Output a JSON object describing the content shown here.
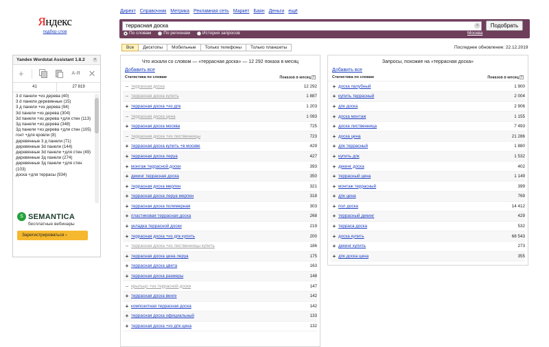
{
  "logo": {
    "main": "Яндекс",
    "sub": "подбор слов"
  },
  "topnav": [
    "Директ",
    "Справочник",
    "Метрика",
    "Рекламная сеть",
    "Маркет",
    "Баян",
    "Деньги",
    "ещё"
  ],
  "search": {
    "value": "террасная доска",
    "submit_label": "Подобрать",
    "modes": [
      "По словам",
      "По регионам",
      "История запросов"
    ],
    "region": "Москва"
  },
  "tabs": [
    "Все",
    "Десктопы",
    "Мобильные",
    "Только телефоны",
    "Только планшеты"
  ],
  "last_update": "Последнее обновление: 22.12.2019",
  "left_panel": {
    "title": "Что искали со словом — «террасная доска» — 12 292 показа в месяц",
    "add_all": "Добавить все",
    "col_words": "Статистика по словам",
    "col_shows": "Показов в месяц",
    "rows": [
      {
        "kw": "террасная доска",
        "cnt": "12 292",
        "sign": "−",
        "used": true
      },
      {
        "kw": "террасная доска купить",
        "cnt": "1 887",
        "sign": "−",
        "used": true
      },
      {
        "kw": "террасная доска +из дпк",
        "cnt": "1 203",
        "sign": "+",
        "used": false
      },
      {
        "kw": "террасная доска цена",
        "cnt": "1 093",
        "sign": "−",
        "used": true
      },
      {
        "kw": "террасная доска москва",
        "cnt": "725",
        "sign": "+",
        "used": false
      },
      {
        "kw": "террасная доска +из лиственницы",
        "cnt": "723",
        "sign": "−",
        "used": true
      },
      {
        "kw": "террасная доска купить +в москве",
        "cnt": "429",
        "sign": "+",
        "used": false
      },
      {
        "kw": "террасная доска леруа",
        "cnt": "427",
        "sign": "+",
        "used": false
      },
      {
        "kw": "монтаж террасной доски",
        "cnt": "393",
        "sign": "+",
        "used": false
      },
      {
        "kw": "декинг террасная доска",
        "cnt": "350",
        "sign": "+",
        "used": false
      },
      {
        "kw": "террасная доска мерлен",
        "cnt": "321",
        "sign": "+",
        "used": false
      },
      {
        "kw": "террасная доска леруа мерлен",
        "cnt": "318",
        "sign": "+",
        "used": false
      },
      {
        "kw": "террасная доска полимерная",
        "cnt": "303",
        "sign": "+",
        "used": false
      },
      {
        "kw": "пластиковая террасная доска",
        "cnt": "268",
        "sign": "+",
        "used": false
      },
      {
        "kw": "укладка террасной доски",
        "cnt": "219",
        "sign": "+",
        "used": false
      },
      {
        "kw": "террасная доска +из дпк купить",
        "cnt": "200",
        "sign": "+",
        "used": false
      },
      {
        "kw": "террасная доска +из лиственницы купить",
        "cnt": "186",
        "sign": "−",
        "used": true
      },
      {
        "kw": "террасная доска цена леруа",
        "cnt": "175",
        "sign": "+",
        "used": false
      },
      {
        "kw": "террасная доска цвета",
        "cnt": "163",
        "sign": "+",
        "used": false
      },
      {
        "kw": "террасная доска размеры",
        "cnt": "148",
        "sign": "+",
        "used": false
      },
      {
        "kw": "крыльцо +из террасной доски",
        "cnt": "147",
        "sign": "−",
        "used": true
      },
      {
        "kw": "террасная доска венге",
        "cnt": "142",
        "sign": "+",
        "used": false
      },
      {
        "kw": "композитная террасная доска",
        "cnt": "142",
        "sign": "+",
        "used": false
      },
      {
        "kw": "террасная доска официальный",
        "cnt": "133",
        "sign": "+",
        "used": false
      },
      {
        "kw": "террасная доска +из дпк цена",
        "cnt": "132",
        "sign": "+",
        "used": false
      }
    ]
  },
  "right_panel": {
    "title": "Запросы, похожие на «террасная доска»",
    "add_all": "Добавить все",
    "col_words": "Статистика по словам",
    "col_shows": "Показов в месяц",
    "rows": [
      {
        "kw": "доска палубный",
        "cnt": "1 900",
        "sign": "+"
      },
      {
        "kw": "купить террасный",
        "cnt": "2 004",
        "sign": "+"
      },
      {
        "kw": "дпк доска",
        "cnt": "2 906",
        "sign": "+"
      },
      {
        "kw": "доска монтаж",
        "cnt": "1 155",
        "sign": "+"
      },
      {
        "kw": "доска лиственница",
        "cnt": "7 493",
        "sign": "+"
      },
      {
        "kw": "доска цена",
        "cnt": "21 286",
        "sign": "+"
      },
      {
        "kw": "дпк террасный",
        "cnt": "1 880",
        "sign": "+"
      },
      {
        "kw": "купить дпк",
        "cnt": "1 532",
        "sign": "+"
      },
      {
        "kw": "декинг доска",
        "cnt": "402",
        "sign": "+"
      },
      {
        "kw": "террасный цена",
        "cnt": "1 149",
        "sign": "+"
      },
      {
        "kw": "монтаж террасный",
        "cnt": "399",
        "sign": "+"
      },
      {
        "kw": "дпк цена",
        "cnt": "769",
        "sign": "+"
      },
      {
        "kw": "пол доска",
        "cnt": "14 412",
        "sign": "+"
      },
      {
        "kw": "террасный декинг",
        "cnt": "429",
        "sign": "+"
      },
      {
        "kw": "терраса доска",
        "cnt": "532",
        "sign": "+"
      },
      {
        "kw": "доска купить",
        "cnt": "68 543",
        "sign": "+"
      },
      {
        "kw": "декинг купить",
        "cnt": "273",
        "sign": "+"
      },
      {
        "kw": "дпк доска цена",
        "cnt": "355",
        "sign": "+"
      }
    ]
  },
  "extension": {
    "title": "Yandex Wordstat Assistant 1.8.2",
    "count_left": "41",
    "count_right": "27 819",
    "tools": {
      "az": "А-Я"
    },
    "items": [
      "3 d панели +из дерева (40)",
      "3 d панели деревянные (15)",
      "3 д панели +из дерева (94)",
      "3d панели +из дерева (304)",
      "3d панели +из дерева +для стен (113)",
      "3д панели +из дерева (348)",
      "3д панели +из дерева +для стен (105)",
      "гонт +для кровли (8)",
      "деревянные 3 д панели (71)",
      "деревянные 3d панели (144)",
      "деревянные 3d панели +для стен (49)",
      "деревянные 3д панели (274)",
      "деревянные 3д панели +для стен (103)",
      "доска +для террасы (934)"
    ],
    "promo_name": "SEMANTICA",
    "promo_sub": "бесплатные вебинары",
    "promo_button": "Зарегистрироваться ›"
  }
}
